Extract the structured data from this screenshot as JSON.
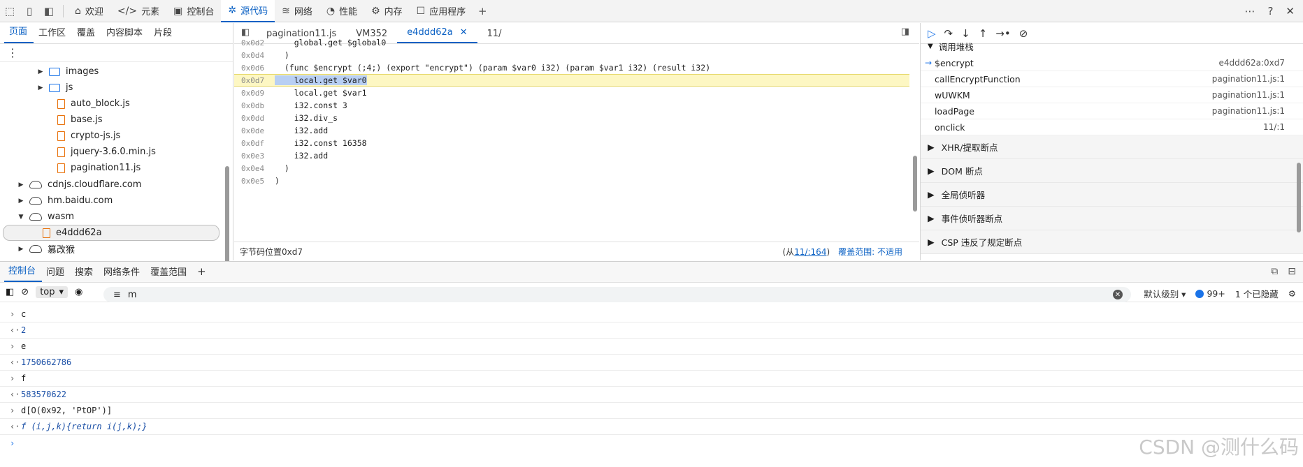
{
  "toolbar": {
    "tabs": [
      {
        "label": "欢迎",
        "icon": "home-icon"
      },
      {
        "label": "元素",
        "icon": "code-icon"
      },
      {
        "label": "控制台",
        "icon": "console-icon"
      },
      {
        "label": "源代码",
        "icon": "bug-icon"
      },
      {
        "label": "网络",
        "icon": "wifi-icon"
      },
      {
        "label": "性能",
        "icon": "gauge-icon"
      },
      {
        "label": "内存",
        "icon": "gear-icon"
      },
      {
        "label": "应用程序",
        "icon": "window-icon"
      }
    ],
    "active_tab": "源代码"
  },
  "navigator": {
    "tabs": [
      "页面",
      "工作区",
      "覆盖",
      "内容脚本",
      "片段"
    ],
    "active_tab": "页面",
    "tree": [
      {
        "label": "images",
        "type": "folder",
        "expanded": false
      },
      {
        "label": "js",
        "type": "folder",
        "expanded": false
      },
      {
        "label": "auto_block.js",
        "type": "file"
      },
      {
        "label": "base.js",
        "type": "file"
      },
      {
        "label": "crypto-js.js",
        "type": "file"
      },
      {
        "label": "jquery-3.6.0.min.js",
        "type": "file"
      },
      {
        "label": "pagination11.js",
        "type": "file"
      },
      {
        "label": "cdnjs.cloudflare.com",
        "type": "domain"
      },
      {
        "label": "hm.baidu.com",
        "type": "domain"
      },
      {
        "label": "wasm",
        "type": "domain",
        "expanded": true
      },
      {
        "label": "e4ddd62a",
        "type": "file",
        "selected": true
      },
      {
        "label": "篡改猴",
        "type": "domain"
      }
    ]
  },
  "editor": {
    "tabs": [
      {
        "label": "pagination11.js"
      },
      {
        "label": "VM352"
      },
      {
        "label": "e4ddd62a",
        "closable": true
      },
      {
        "label": "11/"
      }
    ],
    "active_tab": "e4ddd62a",
    "lines": [
      {
        "addr": "0x0d2",
        "code": "    global.get $global0"
      },
      {
        "addr": "0x0d4",
        "code": "  )"
      },
      {
        "addr": "0x0d6",
        "code": "  (func $encrypt (;4;) (export \"encrypt\") (param $var0 i32) (param $var1 i32) (result i32)"
      },
      {
        "addr": "0x0d7",
        "code": "    local.get $var0"
      },
      {
        "addr": "0x0d9",
        "code": "    local.get $var1"
      },
      {
        "addr": "0x0db",
        "code": "    i32.const 3"
      },
      {
        "addr": "0x0dd",
        "code": "    i32.div_s"
      },
      {
        "addr": "0x0de",
        "code": "    i32.add"
      },
      {
        "addr": "0x0df",
        "code": "    i32.const 16358"
      },
      {
        "addr": "0x0e3",
        "code": "    i32.add"
      },
      {
        "addr": "0x0e4",
        "code": "  )"
      },
      {
        "addr": "0x0e5",
        "code": ")"
      }
    ],
    "status": {
      "position": "字节码位置0xd7",
      "from_prefix": "(从",
      "from_link": "11/:164",
      "from_suffix": ")",
      "coverage": "覆盖范围: 不适用"
    }
  },
  "debugger": {
    "call_stack_title": "调用堆栈",
    "frames": [
      {
        "name": "$encrypt",
        "location": "e4ddd62a:0xd7",
        "current": true
      },
      {
        "name": "callEncryptFunction",
        "location": "pagination11.js:1"
      },
      {
        "name": "wUWKM",
        "location": "pagination11.js:1"
      },
      {
        "name": "loadPage",
        "location": "pagination11.js:1"
      },
      {
        "name": "onclick",
        "location": "11/:1"
      }
    ],
    "sections": [
      "XHR/提取断点",
      "DOM 断点",
      "全局侦听器",
      "事件侦听器断点",
      "CSP 违反了规定断点"
    ]
  },
  "drawer": {
    "tabs": [
      "控制台",
      "问题",
      "搜索",
      "网络条件",
      "覆盖范围"
    ],
    "active_tab": "控制台",
    "context": "top",
    "filter_value": "m",
    "level": "默认级别",
    "issues_count": "99+",
    "hidden": "1 个已隐藏",
    "logs": [
      {
        "kind": "in",
        "text": "c"
      },
      {
        "kind": "out",
        "text": "2"
      },
      {
        "kind": "in",
        "text": "e"
      },
      {
        "kind": "out",
        "text": "1750662786"
      },
      {
        "kind": "in",
        "text": "f"
      },
      {
        "kind": "out",
        "text": "583570622"
      },
      {
        "kind": "in",
        "text": "d[O(0x92, 'PtOP')]"
      },
      {
        "kind": "out",
        "text": "f (i,j,k){return i(j,k);}"
      }
    ]
  },
  "watermark": "CSDN @测什么码"
}
